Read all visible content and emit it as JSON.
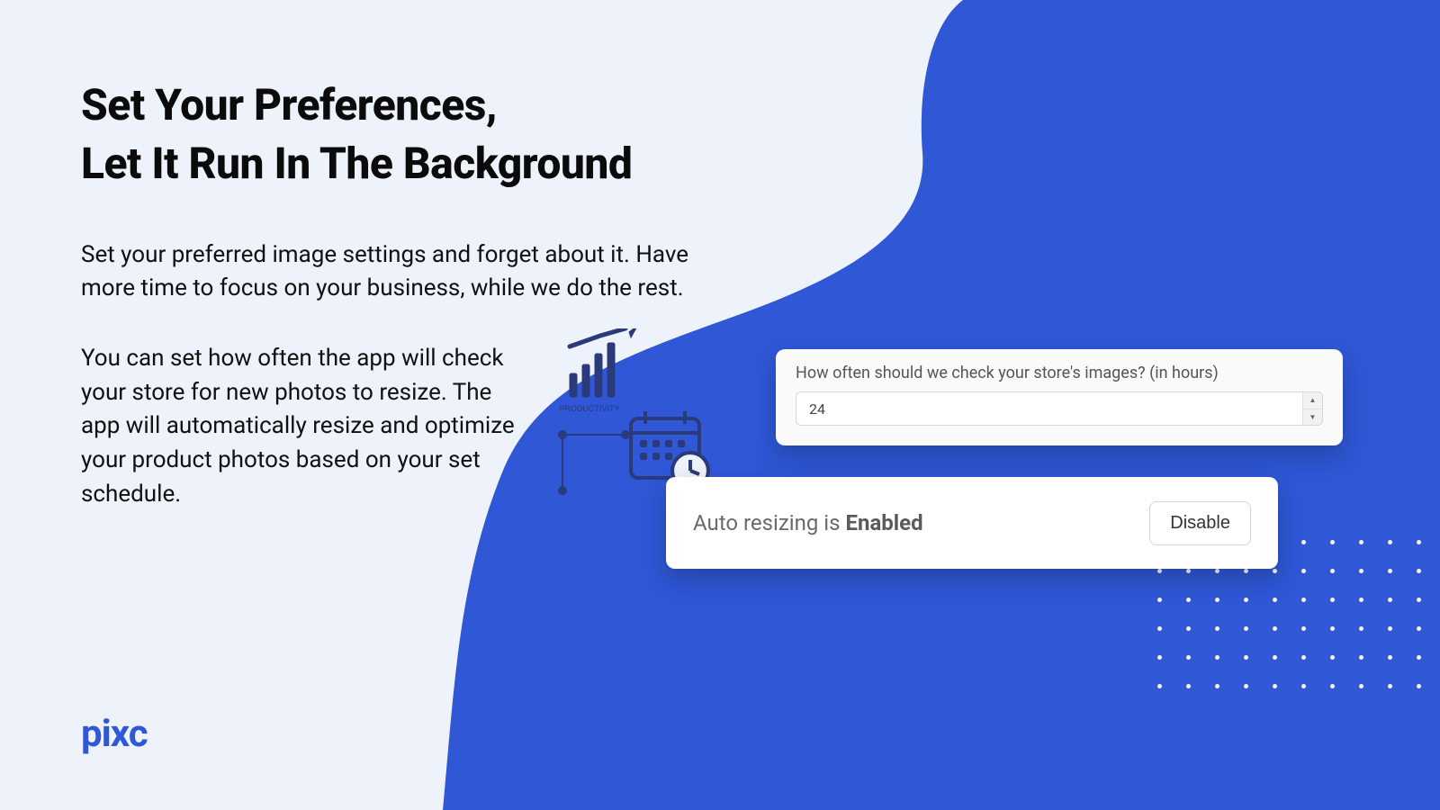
{
  "brand": {
    "name": "pixc"
  },
  "hero": {
    "headline_line1": "Set Your Preferences,",
    "headline_line2": "Let It Run In The Background",
    "paragraph1": "Set your preferred image settings and forget about it. Have more time to focus on your business, while we do the rest.",
    "paragraph2": "You can set how often the app will check your store for new photos to resize. The app will automatically resize and optimize your product photos based on your set schedule."
  },
  "illustration": {
    "caption": "PRODUCTIVITY"
  },
  "settings": {
    "interval": {
      "label": "How often should we check your store's images? (in hours)",
      "value": "24"
    },
    "autoresize": {
      "status_prefix": "Auto resizing is ",
      "status_value": "Enabled",
      "button_label": "Disable"
    }
  },
  "colors": {
    "bg_light": "#EEF2FA",
    "brand_blue": "#2F57D6",
    "text_dark": "#0B0B0B"
  }
}
